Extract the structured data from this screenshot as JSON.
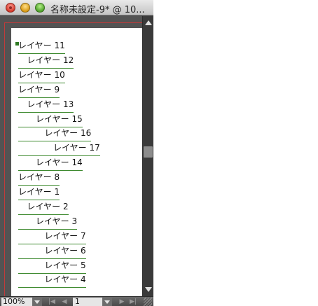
{
  "window": {
    "title": "名称未設定-9* @ 10..."
  },
  "layers": [
    {
      "label": "レイヤー 11",
      "depth": 0
    },
    {
      "label": "レイヤー 12",
      "depth": 1
    },
    {
      "label": "レイヤー 10",
      "depth": 0
    },
    {
      "label": "レイヤー 9",
      "depth": 0
    },
    {
      "label": "レイヤー 13",
      "depth": 1
    },
    {
      "label": "レイヤー 15",
      "depth": 2
    },
    {
      "label": "レイヤー 16",
      "depth": 3
    },
    {
      "label": "レイヤー 17",
      "depth": 4
    },
    {
      "label": "レイヤー 14",
      "depth": 2
    },
    {
      "label": "レイヤー 8",
      "depth": 0
    },
    {
      "label": "レイヤー 1",
      "depth": 0
    },
    {
      "label": "レイヤー 2",
      "depth": 1
    },
    {
      "label": "レイヤー 3",
      "depth": 2
    },
    {
      "label": "レイヤー 7",
      "depth": 3
    },
    {
      "label": "レイヤー 6",
      "depth": 3
    },
    {
      "label": "レイヤー 5",
      "depth": 3
    },
    {
      "label": "レイヤー 4",
      "depth": 3
    }
  ],
  "statusbar": {
    "zoom": "100%",
    "page": "1"
  },
  "colors": {
    "artboard_border": "#c23b3b",
    "layer_underline": "#3e8a2f",
    "pasteboard": "#535353"
  },
  "icons": {
    "close": "close-window-icon",
    "minimize": "minimize-window-icon",
    "zoom": "zoom-window-icon",
    "scroll_up": "scroll-up-arrow-icon",
    "scroll_down": "scroll-down-arrow-icon",
    "first_page": "first-page-icon",
    "prev_page": "previous-page-icon",
    "next_page": "next-page-icon",
    "last_page": "last-page-icon",
    "resize": "resize-grip-icon"
  }
}
